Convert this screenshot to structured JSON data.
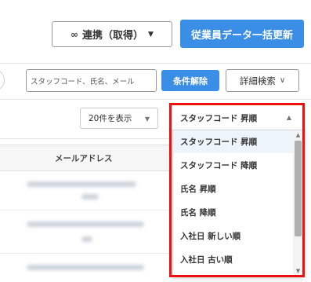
{
  "header": {
    "link_button_label": "連携（取得）",
    "link_button_icon": "link-icon",
    "bulk_update_label": "従業員データ一括更新"
  },
  "search": {
    "placeholder": "スタッフコード、氏名、メール"
  },
  "filters": {
    "clear_label": "条件解除",
    "advanced_label": "詳細検索"
  },
  "list_controls": {
    "per_page_value": "20件を表示",
    "sort_value": "スタッフコード 昇順"
  },
  "table": {
    "columns": [
      "メールアドレス"
    ]
  },
  "sort_dropdown": {
    "options": [
      "スタッフコード 昇順",
      "スタッフコード 降順",
      "氏名 昇順",
      "氏名 降順",
      "入社日 新しい順",
      "入社日 古い順"
    ],
    "selected_index": 0
  },
  "colors": {
    "primary": "#3a8ee6",
    "highlight": "#e11111",
    "selected_option_bg": "#eef4fb"
  }
}
